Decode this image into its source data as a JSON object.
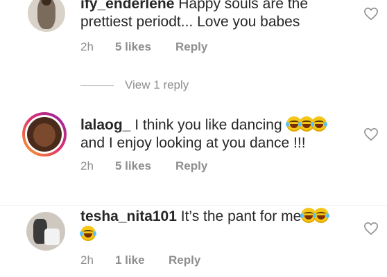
{
  "comments": [
    {
      "username": "ify_enderlene",
      "text_line1": " Happy souls are the",
      "text_line2": "prettiest periodt... Love you babes",
      "time": "2h",
      "likes": "5 likes",
      "reply": "Reply"
    },
    {
      "username": "lalaog_",
      "text_line1": " I think you like dancing ",
      "emoji_line1": "😂😂😂",
      "text_line2": "and I enjoy looking at you dance !!!",
      "time": "2h",
      "likes": "5 likes",
      "reply": "Reply"
    },
    {
      "username": "tesha_nita101",
      "text_line1": " It’s the pant for me",
      "emoji_line1": "😂😂",
      "emoji_line2": "😂",
      "time": "2h",
      "likes": "1 like",
      "reply": "Reply"
    }
  ],
  "view_replies": "View 1 reply",
  "icons": {
    "heart": "heart-outline-icon",
    "emoji": "face-with-tears-of-joy"
  }
}
